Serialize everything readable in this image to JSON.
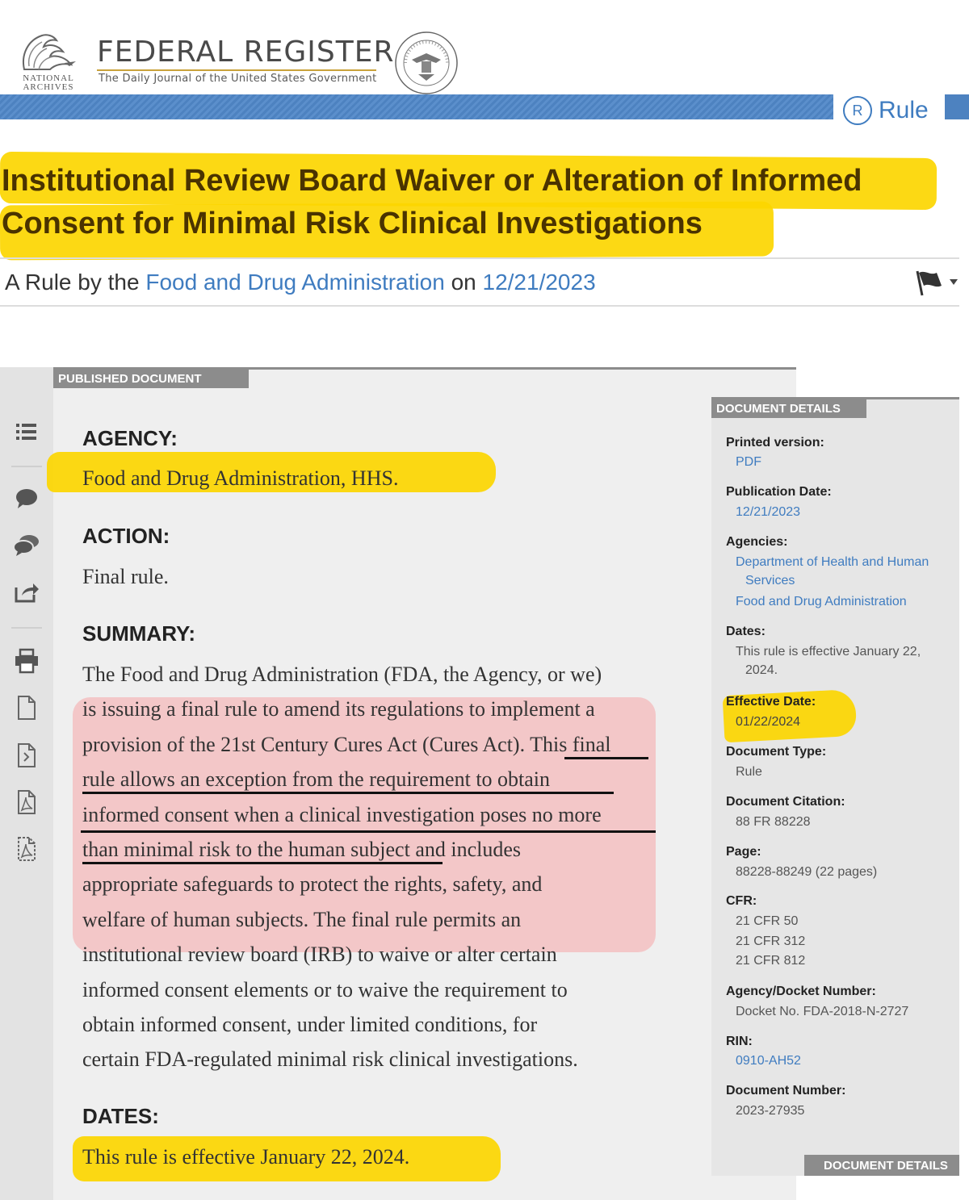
{
  "header": {
    "archives_line1": "NATIONAL",
    "archives_line2": "ARCHIVES",
    "site_title": "FEDERAL REGISTER",
    "site_subtitle": "The Daily Journal of the United States Government",
    "doc_type_letter": "R",
    "doc_type": "Rule"
  },
  "document": {
    "title_line1": "Institutional Review Board Waiver or Alteration of Informed",
    "title_line2": "Consent for Minimal Risk Clinical Investigations",
    "byline_prefix": "A Rule by the",
    "byline_agency": "Food and Drug Administration",
    "byline_on": "on",
    "byline_date": "12/21/2023"
  },
  "published": {
    "tab_label": "PUBLISHED DOCUMENT",
    "agency_heading": "AGENCY:",
    "agency_text": "Food and Drug Administration, HHS.",
    "action_heading": "ACTION:",
    "action_text": "Final rule.",
    "summary_heading": "SUMMARY:",
    "summary_lines": [
      "The Food and Drug Administration (FDA, the Agency, or we)",
      "is issuing a final rule to amend its regulations to implement a",
      "provision of the 21st Century Cures Act (Cures Act). This final",
      "rule allows an exception from the requirement to obtain",
      "informed consent when a clinical investigation poses no more",
      "than minimal risk to the human subject and includes",
      "appropriate safeguards to protect the rights, safety, and",
      "welfare of human subjects. The final rule permits an",
      "institutional review board (IRB) to waive or alter certain",
      "informed consent elements or to waive the requirement to",
      "obtain informed consent, under limited conditions, for",
      "certain FDA-regulated minimal risk clinical investigations."
    ],
    "dates_heading": "DATES:",
    "dates_text": "This rule is effective January 22, 2024."
  },
  "details": {
    "tab_label": "DOCUMENT DETAILS",
    "bottom_tab_label": "DOCUMENT DETAILS",
    "printed_label": "Printed version:",
    "printed_value": "PDF",
    "pubdate_label": "Publication Date:",
    "pubdate_value": "12/21/2023",
    "agencies_label": "Agencies:",
    "agency1_line1": "Department of Health and Human",
    "agency1_line2": "Services",
    "agency2": "Food and Drug Administration",
    "dates_label": "Dates:",
    "dates_line1": "This rule is effective January 22,",
    "dates_line2": "2024.",
    "effective_label": "Effective Date:",
    "effective_value": "01/22/2024",
    "doctype_label": "Document Type:",
    "doctype_value": "Rule",
    "citation_label": "Document Citation:",
    "citation_value": "88 FR 88228",
    "page_label": "Page:",
    "page_value": "88228-88249 (22 pages)",
    "cfr_label": "CFR:",
    "cfr_values": [
      "21 CFR 50",
      "21 CFR 312",
      "21 CFR 812"
    ],
    "docket_label": "Agency/Docket Number:",
    "docket_value": "Docket No. FDA-2018-N-2727",
    "rin_label": "RIN:",
    "rin_value": "0910-AH52",
    "docnum_label": "Document Number:",
    "docnum_value": "2023-27935"
  },
  "rail_icons": [
    "table-of-contents-icon",
    "comment-icon",
    "comments-icon",
    "share-icon",
    "print-icon",
    "document-icon",
    "document-code-icon",
    "pdf-icon",
    "pdf-dashed-icon"
  ],
  "colors": {
    "highlight_yellow": "#fcd600",
    "highlight_pink": "#f3c7c8",
    "link_blue": "#3f7cc0",
    "header_blue": "#4d82c0",
    "title_brown": "#4a3300"
  }
}
